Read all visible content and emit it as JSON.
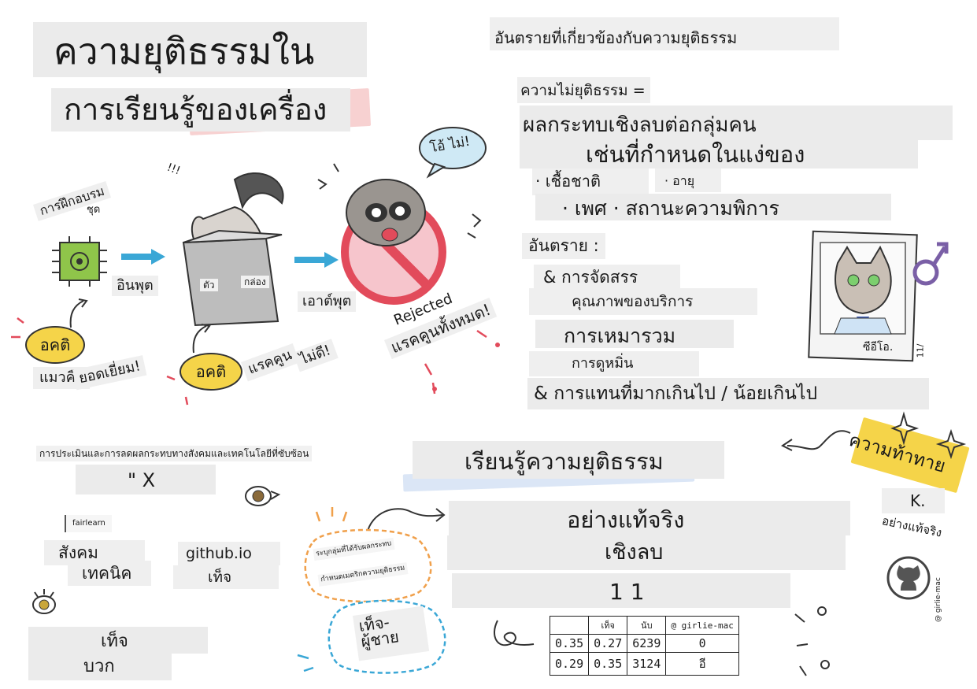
{
  "title": {
    "line1": "ความยุติธรรมใน",
    "line2": "การเรียนรู้ของเครื่อง"
  },
  "left_panel": {
    "training_label": "การฝึกอบรม",
    "set_label": "ชุด",
    "input_label": "อินพุต",
    "output_label": "เอาต์พุต",
    "box_label_1": "ตัว",
    "box_label_2": "กล่อง",
    "bias_1": "อคติ",
    "bias_2": "อคติ",
    "cat_is": "แมวคือ",
    "awesome": "ยอดเยี่ยม!",
    "raccoon": "แรคคูน",
    "not_good": "ไม่ดี!",
    "oh_no": "โอ้ ไม่!",
    "rejected": "Rejected",
    "all_raccoons": "แรคคูนทั้งหมด!",
    "squiggle": "!!!"
  },
  "harms": {
    "heading": "อันตรายที่เกี่ยวข้องกับความยุติธรรม",
    "unfairness": "ความไม่ยุติธรรม =",
    "line1": "ผลกระทบเชิงลบต่อกลุ่มคน",
    "line2": "เช่นที่กำหนดในแง่ของ",
    "race": "· เชื้อชาติ",
    "age": "· อายุ",
    "gender_disability": "· เพศ · สถานะความพิการ",
    "harm_title": "อันตราย :",
    "allocation": "& การจัดสรร",
    "quality": "คุณภาพของบริการ",
    "stereotyping": "การเหมารวม",
    "denigration": "การดูหมิ่น",
    "representation": "& การแทนที่มากเกินไป / น้อยเกินไป",
    "ceo_label": "ซีอีโอ.",
    "photo_mark": "11/"
  },
  "tools": {
    "heading": "การประเมินและการลดผลกระทบทางสังคมและเทคโนโลยีที่ซับซ้อน",
    "x_mark": "\" X",
    "fairlearn": "fairlearn",
    "social": "สังคม",
    "technical": "เทคนิค",
    "github": "github.io",
    "fake": "เท็จ",
    "false_label": "เท็จ",
    "positive": "บวก"
  },
  "learn": {
    "heading": "เรียนรู้ความยุติธรรม",
    "genuinely": "อย่างแท้จริง",
    "negative": "เชิงลบ",
    "eleven": "1 1",
    "identify_groups": "ระบุกลุ่มที่ได้รับผลกระทบ",
    "define_metrics": "กำหนดเมตริกความยุติธรรม",
    "false_male": "เท็จ-\nผู้ชาย",
    "challenge": "ความท้าทาย",
    "k": "K.",
    "really": "อย่างแท้จริง",
    "credit": "@ girlie-mac"
  },
  "table": {
    "headers": [
      "",
      "เท็จ",
      "นับ",
      "@ girlie-mac"
    ],
    "rows": [
      [
        "0.35",
        "0.27",
        "6239",
        "0"
      ],
      [
        "0.29",
        "0.35",
        "3124",
        "อี"
      ]
    ]
  },
  "colors": {
    "accent_blue": "#3aa7d6",
    "badge_yellow": "#f5d449",
    "stop_red": "#e24b5b",
    "tape_pink": "#f7c8c8"
  }
}
